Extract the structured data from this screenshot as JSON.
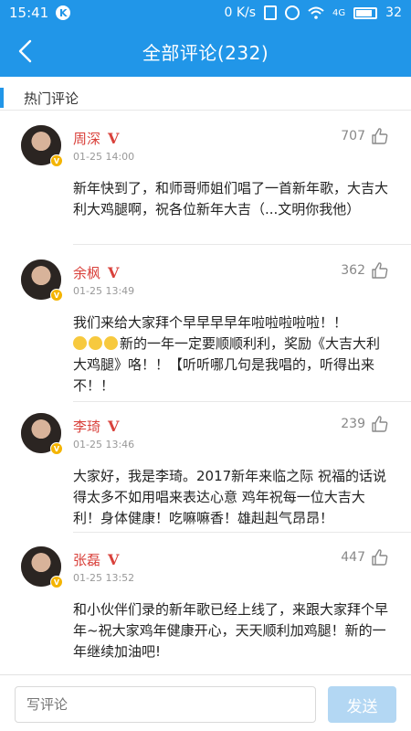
{
  "status_bar": {
    "time": "15:41",
    "k_badge": "K",
    "net_speed": "0 K/s",
    "signal_label": "4G",
    "battery": "32"
  },
  "header": {
    "title": "全部评论(232)"
  },
  "section": {
    "label": "热门评论"
  },
  "comments": [
    {
      "name": "周深",
      "verified": "V",
      "time": "01-25 14:00",
      "likes": "707",
      "text": "新年快到了，和师哥师姐们唱了一首新年歌，大吉大利大鸡腿啊，祝各位新年大吉（...文明你我他）"
    },
    {
      "name": "余枫",
      "verified": "V",
      "time": "01-25 13:49",
      "likes": "362",
      "text_line1": "我们来给大家拜个早早早早年啦啦啦啦啦！！",
      "text_rest": "新的一年一定要顺顺利利，奖励《大吉大利大鸡腿》咯！！【听听哪几句是我唱的，听得出来不！！"
    },
    {
      "name": "李琦",
      "verified": "V",
      "time": "01-25 13:46",
      "likes": "239",
      "text": "大家好，我是李琦。2017新年来临之际 祝福的话说得太多不如用唱来表达心意 鸡年祝每一位大吉大利！身体健康！吃嘛嘛香！雄赳赳气昂昂！"
    },
    {
      "name": "张磊",
      "verified": "V",
      "time": "01-25 13:52",
      "likes": "447",
      "text": "和小伙伴们录的新年歌已经上线了，来跟大家拜个早年~祝大家鸡年健康开心，天天顺利加鸡腿！新的一年继续加油吧!"
    }
  ],
  "composer": {
    "placeholder": "写评论",
    "send_label": "发送"
  },
  "colors": {
    "accent": "#2196e8",
    "name_red": "#d9413b",
    "send_disabled": "#b3d7f3"
  }
}
